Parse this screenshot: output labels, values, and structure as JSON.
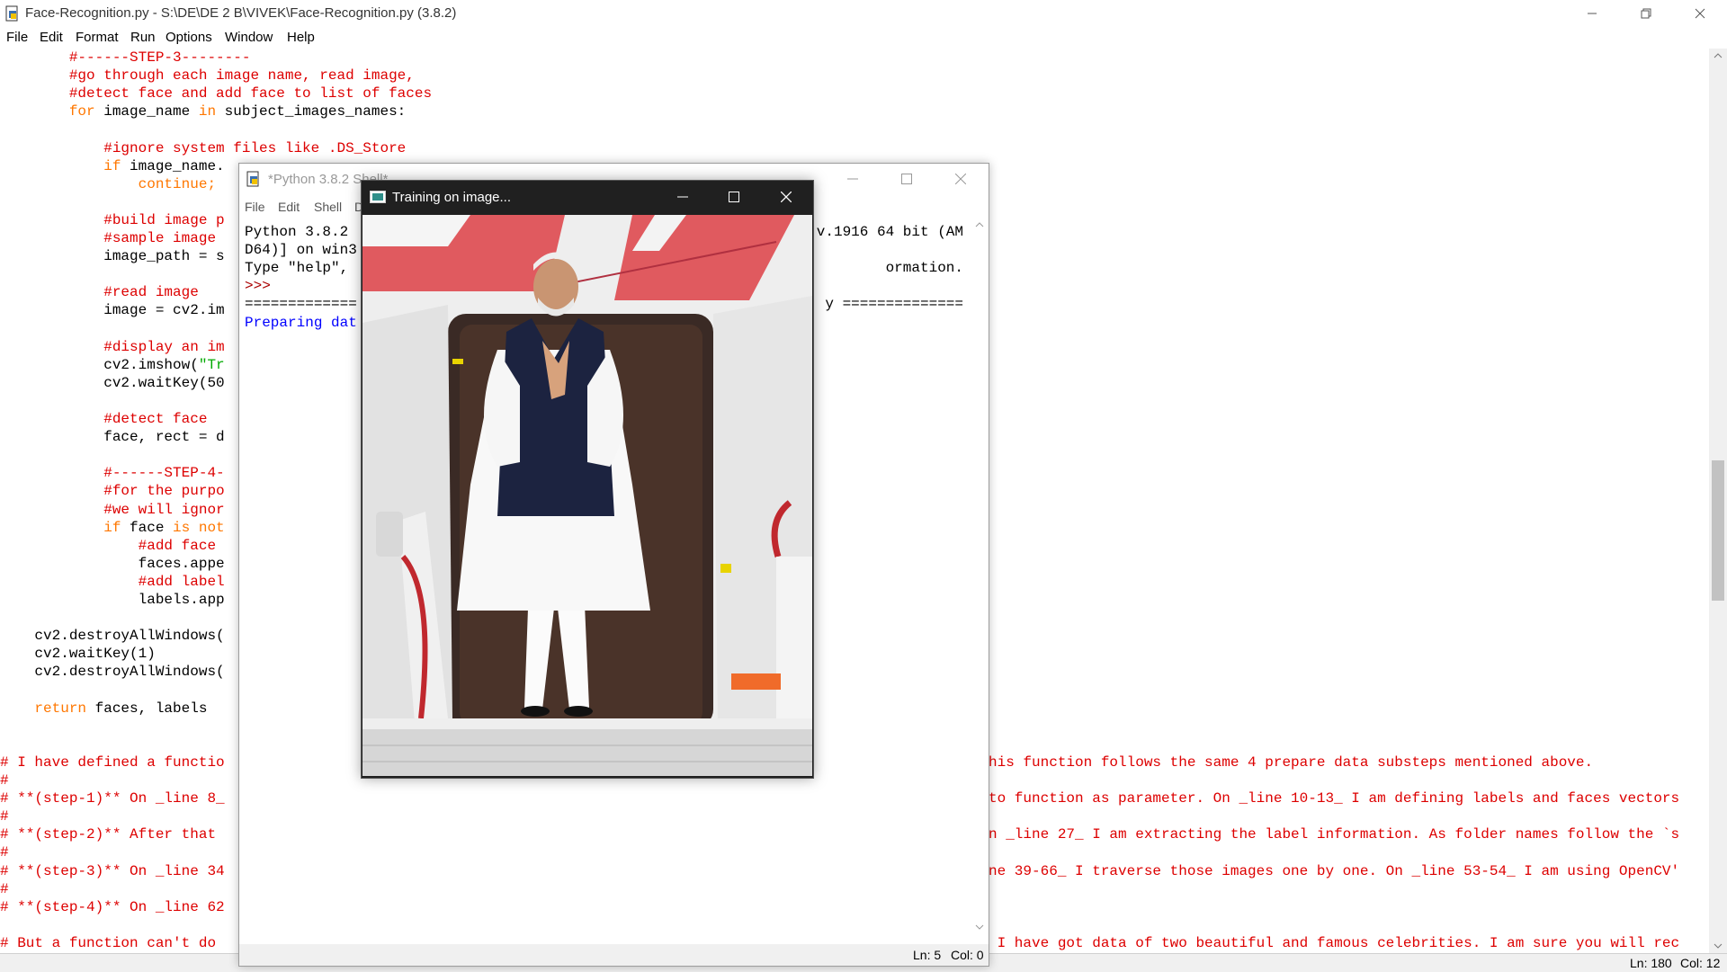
{
  "main_window": {
    "title": "Face-Recognition.py - S:\\DE\\DE 2 B\\VIVEK\\Face-Recognition.py (3.8.2)",
    "menu": [
      "File",
      "Edit",
      "Format",
      "Run",
      "Options",
      "Window",
      "Help"
    ],
    "status": {
      "line": "Ln: 180",
      "col": "Col: 12"
    }
  },
  "code_lines": [
    {
      "indent": "        ",
      "segments": [
        {
          "t": "#------STEP-3--------",
          "c": "cm"
        }
      ]
    },
    {
      "indent": "        ",
      "segments": [
        {
          "t": "#go through each image name, read image,",
          "c": "cm"
        }
      ]
    },
    {
      "indent": "        ",
      "segments": [
        {
          "t": "#detect face and add face to list of faces",
          "c": "cm"
        }
      ]
    },
    {
      "indent": "        ",
      "segments": [
        {
          "t": "for",
          "c": "kw"
        },
        {
          "t": " image_name ",
          "c": ""
        },
        {
          "t": "in",
          "c": "kw"
        },
        {
          "t": " subject_images_names:",
          "c": ""
        }
      ]
    },
    {
      "indent": "",
      "segments": []
    },
    {
      "indent": "            ",
      "segments": [
        {
          "t": "#ignore system files like .DS_Store",
          "c": "cm"
        }
      ]
    },
    {
      "indent": "            ",
      "segments": [
        {
          "t": "if",
          "c": "kw"
        },
        {
          "t": " image_name.",
          "c": ""
        }
      ]
    },
    {
      "indent": "                ",
      "segments": [
        {
          "t": "continue;",
          "c": "kw"
        }
      ]
    },
    {
      "indent": "",
      "segments": []
    },
    {
      "indent": "            ",
      "segments": [
        {
          "t": "#build image p",
          "c": "cm"
        }
      ]
    },
    {
      "indent": "            ",
      "segments": [
        {
          "t": "#sample image",
          "c": "cm"
        }
      ]
    },
    {
      "indent": "            ",
      "segments": [
        {
          "t": "image_path = s",
          "c": ""
        }
      ]
    },
    {
      "indent": "",
      "segments": []
    },
    {
      "indent": "            ",
      "segments": [
        {
          "t": "#read image",
          "c": "cm"
        }
      ]
    },
    {
      "indent": "            ",
      "segments": [
        {
          "t": "image = cv2.im",
          "c": ""
        }
      ]
    },
    {
      "indent": "",
      "segments": []
    },
    {
      "indent": "            ",
      "segments": [
        {
          "t": "#display an im",
          "c": "cm"
        }
      ]
    },
    {
      "indent": "            ",
      "segments": [
        {
          "t": "cv2.imshow(",
          "c": ""
        },
        {
          "t": "\"Tr",
          "c": "str"
        }
      ]
    },
    {
      "indent": "            ",
      "segments": [
        {
          "t": "cv2.waitKey(50",
          "c": ""
        }
      ]
    },
    {
      "indent": "",
      "segments": []
    },
    {
      "indent": "            ",
      "segments": [
        {
          "t": "#detect face",
          "c": "cm"
        }
      ]
    },
    {
      "indent": "            ",
      "segments": [
        {
          "t": "face, rect = d",
          "c": ""
        }
      ]
    },
    {
      "indent": "",
      "segments": []
    },
    {
      "indent": "            ",
      "segments": [
        {
          "t": "#------STEP-4-",
          "c": "cm"
        }
      ]
    },
    {
      "indent": "            ",
      "segments": [
        {
          "t": "#for the purpo",
          "c": "cm"
        }
      ]
    },
    {
      "indent": "            ",
      "segments": [
        {
          "t": "#we will ignor",
          "c": "cm"
        }
      ]
    },
    {
      "indent": "            ",
      "segments": [
        {
          "t": "if",
          "c": "kw"
        },
        {
          "t": " face ",
          "c": ""
        },
        {
          "t": "is not",
          "c": "kw"
        }
      ]
    },
    {
      "indent": "                ",
      "segments": [
        {
          "t": "#add face",
          "c": "cm"
        }
      ]
    },
    {
      "indent": "                ",
      "segments": [
        {
          "t": "faces.appe",
          "c": ""
        }
      ]
    },
    {
      "indent": "                ",
      "segments": [
        {
          "t": "#add label",
          "c": "cm"
        }
      ]
    },
    {
      "indent": "                ",
      "segments": [
        {
          "t": "labels.app",
          "c": ""
        }
      ]
    },
    {
      "indent": "",
      "segments": []
    },
    {
      "indent": "    ",
      "segments": [
        {
          "t": "cv2.destroyAllWindows(",
          "c": ""
        }
      ]
    },
    {
      "indent": "    ",
      "segments": [
        {
          "t": "cv2.waitKey(1)",
          "c": ""
        }
      ]
    },
    {
      "indent": "    ",
      "segments": [
        {
          "t": "cv2.destroyAllWindows(",
          "c": ""
        }
      ]
    },
    {
      "indent": "",
      "segments": []
    },
    {
      "indent": "    ",
      "segments": [
        {
          "t": "return",
          "c": "kw"
        },
        {
          "t": " faces, labels",
          "c": ""
        }
      ]
    },
    {
      "indent": "",
      "segments": []
    },
    {
      "indent": "",
      "segments": []
    },
    {
      "indent": "",
      "segments": [
        {
          "t": "# I have defined a functio",
          "c": "cm"
        }
      ]
    },
    {
      "indent": "",
      "segments": [
        {
          "t": "#",
          "c": "cm"
        }
      ]
    },
    {
      "indent": "",
      "segments": [
        {
          "t": "# **(step-1)** On _line 8_",
          "c": "cm"
        }
      ]
    },
    {
      "indent": "",
      "segments": [
        {
          "t": "#",
          "c": "cm"
        }
      ]
    },
    {
      "indent": "",
      "segments": [
        {
          "t": "# **(step-2)** After that",
          "c": "cm"
        }
      ]
    },
    {
      "indent": "",
      "segments": [
        {
          "t": "#",
          "c": "cm"
        }
      ]
    },
    {
      "indent": "",
      "segments": [
        {
          "t": "# **(step-3)** On _line 34",
          "c": "cm"
        }
      ]
    },
    {
      "indent": "",
      "segments": [
        {
          "t": "#",
          "c": "cm"
        }
      ]
    },
    {
      "indent": "",
      "segments": [
        {
          "t": "# **(step-4)** On _line 62",
          "c": "cm"
        }
      ]
    },
    {
      "indent": "",
      "segments": []
    },
    {
      "indent": "",
      "segments": [
        {
          "t": "# But a function can't do",
          "c": "cm"
        }
      ]
    }
  ],
  "right_fragments": [
    {
      "line": 39,
      "text": "his function follows the same 4 prepare data substeps mentioned above."
    },
    {
      "line": 41,
      "text": "to function as parameter. On _line 10-13_ I am defining labels and faces vectors"
    },
    {
      "line": 43,
      "text": "n _line 27_ I am extracting the label information. As folder names follow the `s"
    },
    {
      "line": 45,
      "text": "ne 39-66_ I traverse those images one by one. On _line 53-54_ I am using OpenCV'"
    },
    {
      "line": 49,
      "text": " I have got data of two beautiful and famous celebrities. I am sure you will rec"
    }
  ],
  "shell_window": {
    "title": "*Python 3.8.2 Shell*",
    "menu": [
      "File",
      "Edit",
      "Shell",
      "D"
    ],
    "lines": [
      {
        "left": "Python 3.8.2 ",
        "right": "v.1916 64 bit (AM"
      },
      {
        "left": "D64)] on win3",
        "right": ""
      },
      {
        "left": "Type \"help\", ",
        "right": "ormation."
      },
      {
        "left": ">>>",
        "right": "",
        "prompt": true
      },
      {
        "left": "=============",
        "right": "y =============="
      },
      {
        "left": "Preparing dat",
        "right": "",
        "blue": true
      }
    ],
    "status": {
      "line": "Ln: 5",
      "col": "Col: 0"
    }
  },
  "image_window": {
    "title": "Training on image..."
  },
  "colors": {
    "keyword": "#ff7700",
    "comment": "#dd0000",
    "string": "#00aa00",
    "shell_output": "#0000ff"
  }
}
